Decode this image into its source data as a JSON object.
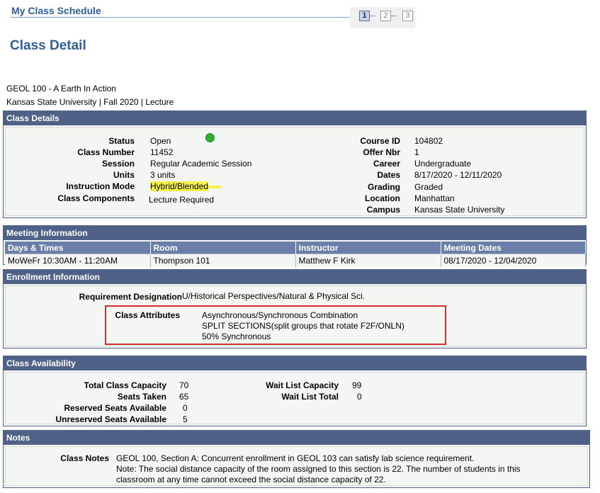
{
  "header": {
    "page_title": "My Class Schedule",
    "steps": [
      "1",
      "2",
      "3"
    ],
    "active_step": "1",
    "heading": "Class Detail"
  },
  "class_info": {
    "line1": "GEOL  100 - A   Earth In Action",
    "line2": "Kansas State University | Fall 2020 | Lecture"
  },
  "class_details": {
    "title": "Class Details",
    "left": [
      {
        "label": "Status",
        "value": "Open"
      },
      {
        "label": "Class Number",
        "value": "11452"
      },
      {
        "label": "Session",
        "value": "Regular Academic Session"
      },
      {
        "label": "Units",
        "value": "3 units"
      },
      {
        "label": "Instruction Mode",
        "value": "Hybrid/Blended"
      },
      {
        "label": "Class Components",
        "value": "Lecture Required"
      }
    ],
    "right": [
      {
        "label": "Course ID",
        "value": "104802"
      },
      {
        "label": "Offer Nbr",
        "value": "1"
      },
      {
        "label": "Career",
        "value": "Undergraduate"
      },
      {
        "label": "Dates",
        "value": "8/17/2020 - 12/11/2020"
      },
      {
        "label": "Grading",
        "value": "Graded"
      },
      {
        "label": "Location",
        "value": "Manhattan"
      },
      {
        "label": "Campus",
        "value": "Kansas State University"
      }
    ],
    "status_icon": "green-circle-icon",
    "status_color": "#2eb12e",
    "highlight_color": "#f6f04a"
  },
  "meeting": {
    "title": "Meeting Information",
    "columns": [
      "Days & Times",
      "Room",
      "Instructor",
      "Meeting Dates"
    ],
    "row": [
      "MoWeFr 10:30AM - 11:20AM",
      "Thompson 101",
      "Matthew F Kirk",
      "08/17/2020 - 12/04/2020"
    ]
  },
  "enrollment": {
    "title": "Enrollment Information",
    "req_label": "Requirement Designation",
    "req_value": "U/Historical Perspectives/Natural & Physical Sci.",
    "attr_label": "Class Attributes",
    "attributes": [
      "Asynchronous/Synchronous Combination",
      "SPLIT SECTIONS(split groups that rotate F2F/ONLN)",
      "50% Synchronous"
    ],
    "box_color": "#d32f2f"
  },
  "availability": {
    "title": "Class Availability",
    "left": [
      {
        "label": "Total Class Capacity",
        "value": "70"
      },
      {
        "label": "Seats Taken",
        "value": "65"
      },
      {
        "label": "Reserved Seats Available",
        "value": "0"
      },
      {
        "label": "Unreserved Seats Available",
        "value": "5"
      }
    ],
    "right": [
      {
        "label": "Wait List Capacity",
        "value": "99"
      },
      {
        "label": "Wait List Total",
        "value": "0"
      }
    ]
  },
  "notes": {
    "title": "Notes",
    "label": "Class Notes",
    "lines": [
      "GEOL 100, Section A: Concurrent enrollment in GEOL 103 can satisfy lab science requirement.",
      "Note: The social distance capacity of the room assigned to this section is 22.  The number of students in this",
      "classroom at any time cannot exceed the social distance capacity of 22."
    ]
  },
  "theme": {
    "header_bar": "#4f6187",
    "title_color": "#2f5e99",
    "panel_bg": "#f4f6f3"
  }
}
